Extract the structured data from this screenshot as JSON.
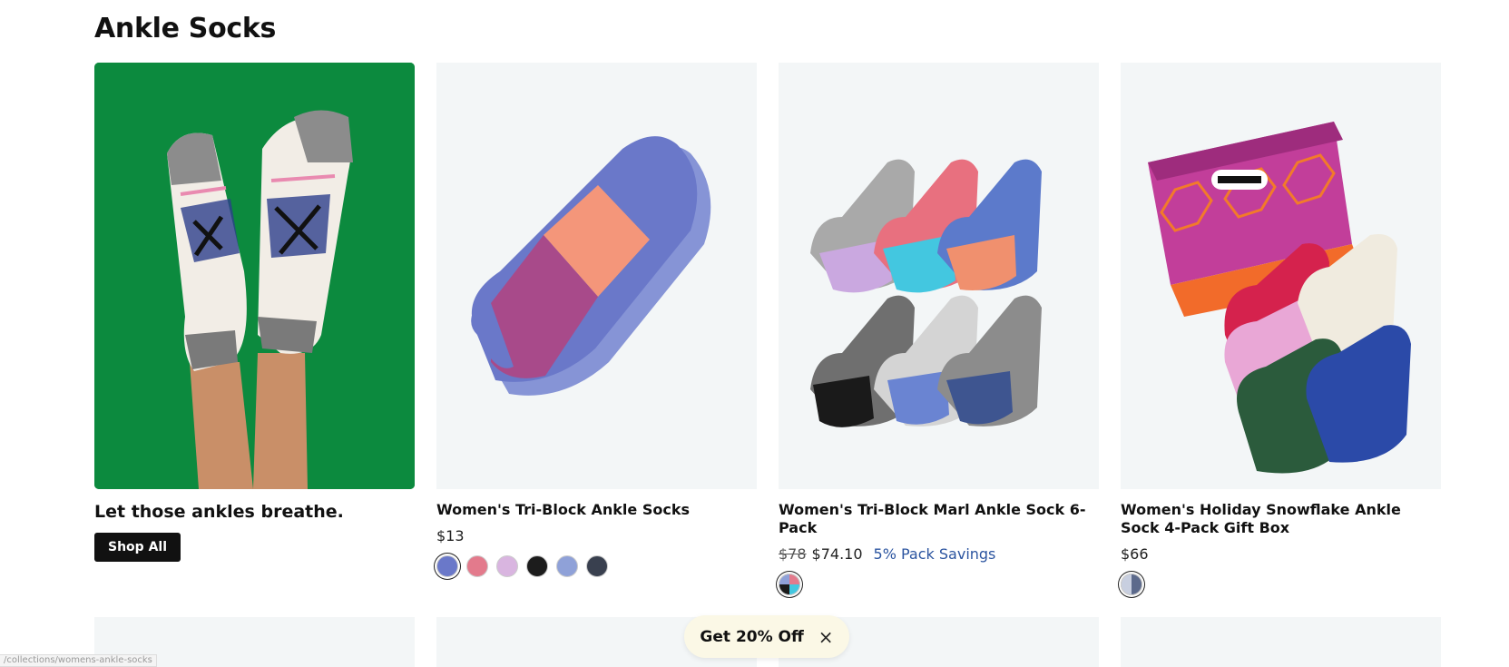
{
  "section": {
    "title": "Ankle Socks"
  },
  "promo": {
    "tagline": "Let those ankles breathe.",
    "button_label": "Shop All"
  },
  "products": [
    {
      "name": "Women's Tri-Block Ankle Socks",
      "price": "$13",
      "swatches": [
        "#6a78c9",
        "#e37a8c",
        "#d9b5e0",
        "#1c1c1c",
        "#8fa1d8",
        "#39404f"
      ],
      "selected_swatch": 0
    },
    {
      "name": "Women's Tri-Block Marl Ankle Sock 6-Pack",
      "original_price": "$78",
      "price": "$74.10",
      "savings": "5% Pack Savings",
      "swatches": [
        "#c77bb0"
      ],
      "selected_swatch": 0
    },
    {
      "name": "Women's Holiday Snowflake Ankle Sock 4-Pack Gift Box",
      "price": "$66",
      "swatches": [
        "#8b93a8"
      ],
      "selected_swatch": 0
    }
  ],
  "offer": {
    "label": "Get 20% Off",
    "close_icon": "×"
  },
  "status_bar": {
    "url": "/collections/womens-ankle-socks"
  },
  "colors": {
    "promo_bg": "#0c8a3e",
    "card_bg": "#f3f6f7",
    "button_bg": "#111111",
    "savings_text": "#2c55a0",
    "offer_bg": "#fbf8e6"
  }
}
